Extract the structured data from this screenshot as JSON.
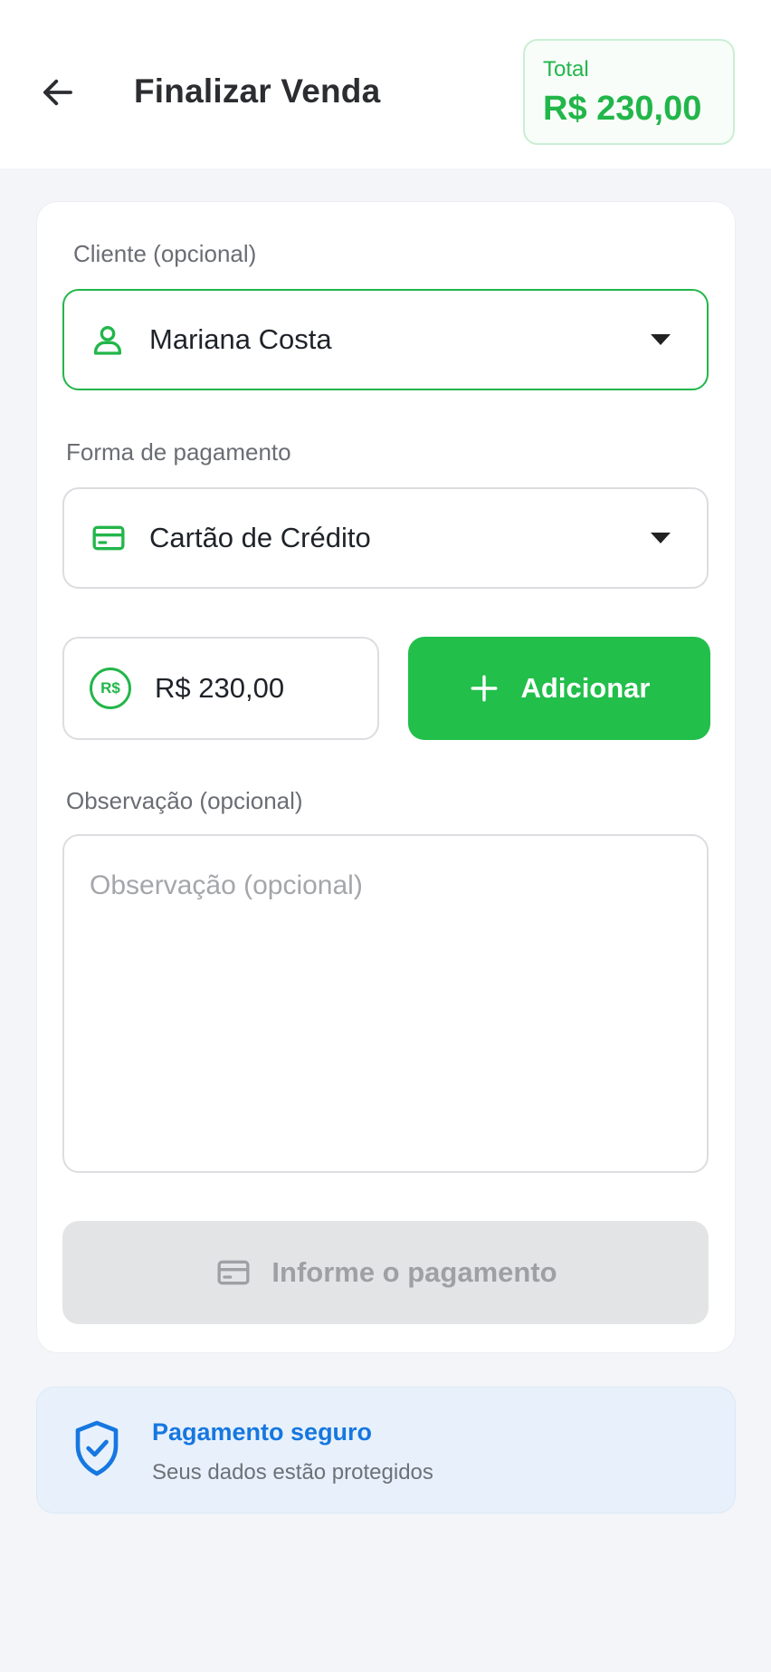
{
  "header": {
    "title": "Finalizar Venda",
    "total_label": "Total",
    "total_value": "R$ 230,00"
  },
  "form": {
    "client_label": "Cliente (opcional)",
    "client_value": "Mariana Costa",
    "payment_label": "Forma de pagamento",
    "payment_value": "Cartão de Crédito",
    "amount_value": "R$ 230,00",
    "amount_icon_text": "R$",
    "add_button_label": "Adicionar",
    "note_label": "Observação (opcional)",
    "note_placeholder": "Observação (opcional)",
    "submit_label": "Informe o pagamento"
  },
  "secure": {
    "title": "Pagamento seguro",
    "subtitle": "Seus dados estão protegidos"
  },
  "colors": {
    "accent_green": "#22bf4b",
    "secure_blue": "#1677e0",
    "disabled_gray": "#e3e4e6"
  },
  "icons": {
    "back": "arrow-left-icon",
    "client": "user-icon",
    "payment": "credit-card-icon",
    "amount": "currency-circle-icon",
    "add": "plus-icon",
    "submit": "credit-card-icon",
    "secure": "shield-check-icon"
  }
}
